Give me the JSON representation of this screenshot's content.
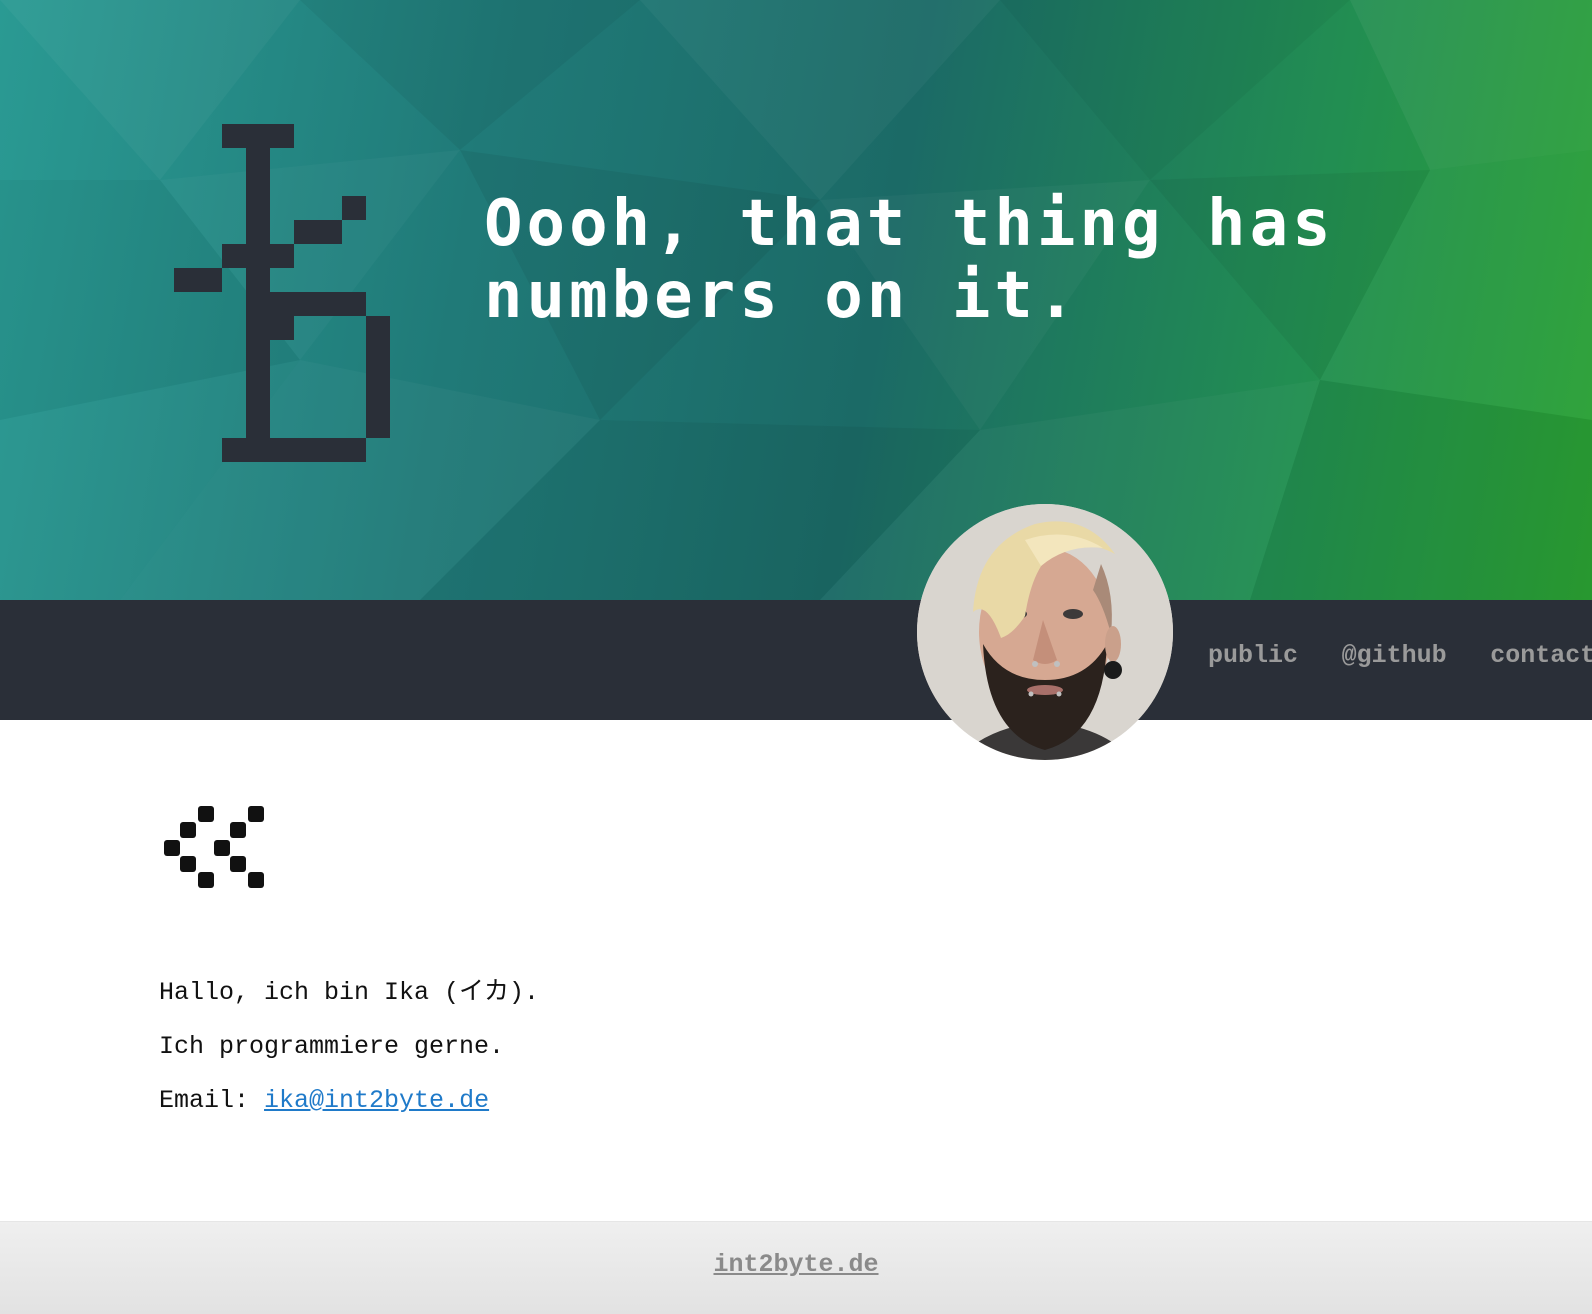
{
  "hero": {
    "tagline": "Oooh, that thing has numbers on it."
  },
  "nav": {
    "links": [
      {
        "label": "public"
      },
      {
        "label": "@github"
      },
      {
        "label": "contact"
      }
    ]
  },
  "avatar": {
    "icon": "profile-photo"
  },
  "content": {
    "back_icon": "double-chevron-left-icon",
    "greeting": "Hallo, ich bin Ika (イカ).",
    "intro": "Ich programmiere gerne.",
    "email_label": "Email:",
    "email": "ika@int2byte.de"
  },
  "footer": {
    "link": "int2byte.de"
  },
  "colors": {
    "hero_start": "#2a9a93",
    "hero_end": "#2ba233",
    "navbar": "#2a2f38",
    "nav_link": "#9a9a9a",
    "link": "#1f7ac9",
    "footer_bg": "#e9e9e9",
    "footer_link": "#8a8a8a"
  }
}
